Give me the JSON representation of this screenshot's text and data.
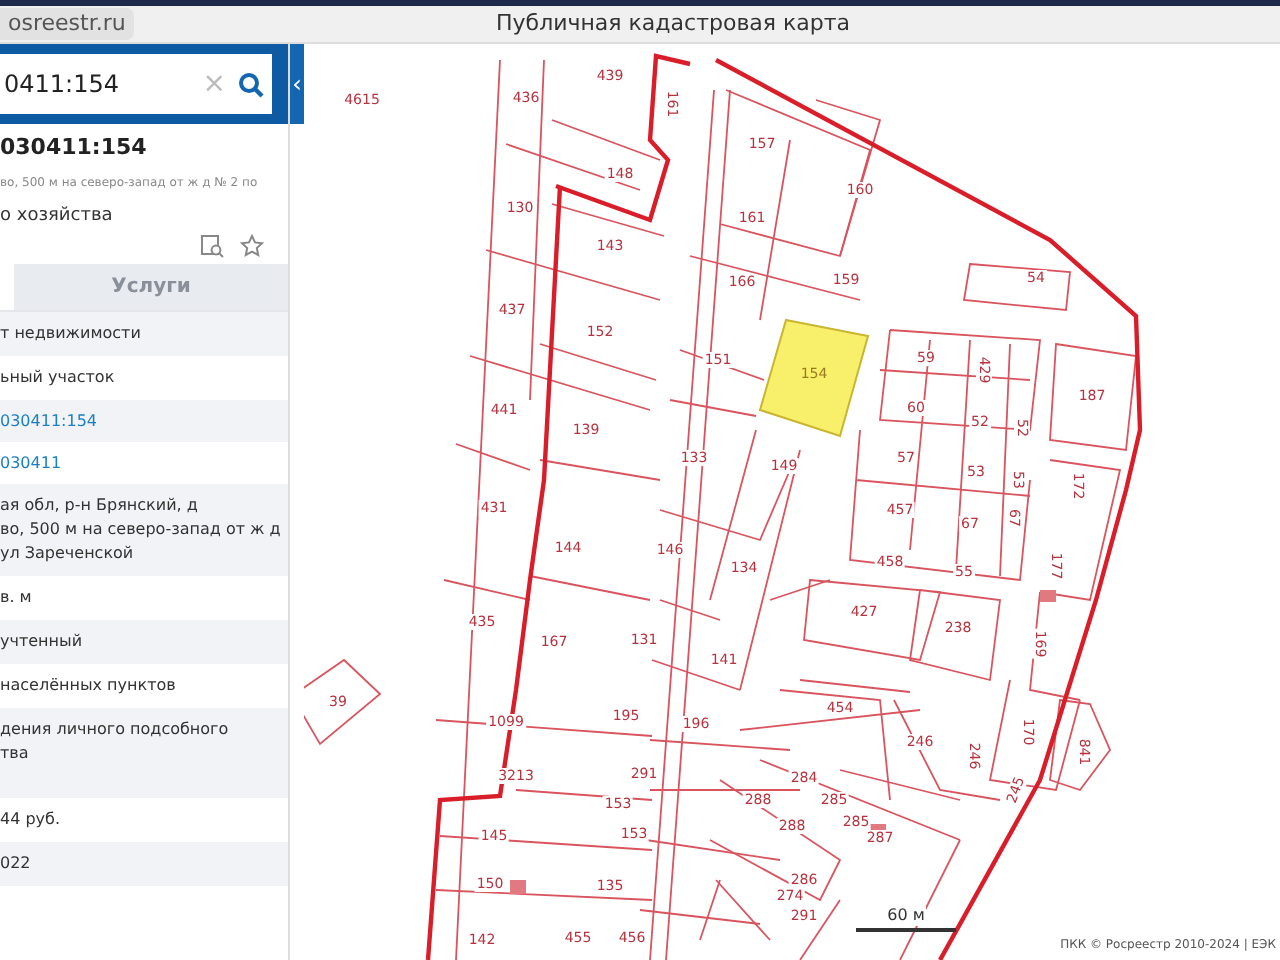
{
  "browser": {
    "url": "osreestr.ru",
    "title": "Публичная кадастровая карта"
  },
  "search": {
    "value": "0411:154",
    "clear": "×"
  },
  "collapse": "‹",
  "object": {
    "title": "030411:154",
    "address": "во, 500 м на северо-запад от ж д № 2 по",
    "usage": "о хозяйства"
  },
  "tabs": [
    {
      "label": "Услуги",
      "selected": false
    }
  ],
  "rows": [
    {
      "kind": "text",
      "lines": [
        "т недвижимости"
      ]
    },
    {
      "kind": "text",
      "lines": [
        "ьный участок"
      ]
    },
    {
      "kind": "link",
      "lines": [
        "030411:154"
      ]
    },
    {
      "kind": "link",
      "lines": [
        "030411"
      ]
    },
    {
      "kind": "text",
      "lines": [
        "ая обл, р-н Брянский, д",
        "во, 500 м на северо-запад от ж д",
        "ул Зареченской"
      ]
    },
    {
      "kind": "text",
      "lines": [
        "в. м"
      ]
    },
    {
      "kind": "text",
      "lines": [
        "учтенный"
      ]
    },
    {
      "kind": "text",
      "lines": [
        "населённых пунктов"
      ]
    },
    {
      "kind": "text",
      "lines": [
        "дения личного подсобного",
        "тва"
      ]
    },
    {
      "kind": "text",
      "lines": [
        "44 руб."
      ]
    },
    {
      "kind": "text",
      "lines": [
        "022"
      ]
    }
  ],
  "map": {
    "parcels": [
      {
        "number": "4615",
        "selected": false
      },
      {
        "number": "436",
        "selected": false
      },
      {
        "number": "439",
        "selected": false
      },
      {
        "number": "161",
        "selected": false
      },
      {
        "number": "157",
        "selected": false
      },
      {
        "number": "160",
        "selected": false
      },
      {
        "number": "148",
        "selected": false
      },
      {
        "number": "130",
        "selected": false
      },
      {
        "number": "143",
        "selected": false
      },
      {
        "number": "161",
        "selected": false
      },
      {
        "number": "166",
        "selected": false
      },
      {
        "number": "159",
        "selected": false
      },
      {
        "number": "54",
        "selected": false
      },
      {
        "number": "437",
        "selected": false
      },
      {
        "number": "152",
        "selected": false
      },
      {
        "number": "151",
        "selected": false
      },
      {
        "number": "154",
        "selected": true
      },
      {
        "number": "59",
        "selected": false
      },
      {
        "number": "429",
        "selected": false
      },
      {
        "number": "187",
        "selected": false
      },
      {
        "number": "60",
        "selected": false
      },
      {
        "number": "52",
        "selected": false
      },
      {
        "number": "52",
        "selected": false
      },
      {
        "number": "441",
        "selected": false
      },
      {
        "number": "139",
        "selected": false
      },
      {
        "number": "133",
        "selected": false
      },
      {
        "number": "149",
        "selected": false
      },
      {
        "number": "57",
        "selected": false
      },
      {
        "number": "53",
        "selected": false
      },
      {
        "number": "53",
        "selected": false
      },
      {
        "number": "172",
        "selected": false
      },
      {
        "number": "431",
        "selected": false
      },
      {
        "number": "144",
        "selected": false
      },
      {
        "number": "146",
        "selected": false
      },
      {
        "number": "134",
        "selected": false
      },
      {
        "number": "457",
        "selected": false
      },
      {
        "number": "67",
        "selected": false
      },
      {
        "number": "67",
        "selected": false
      },
      {
        "number": "458",
        "selected": false
      },
      {
        "number": "55",
        "selected": false
      },
      {
        "number": "177",
        "selected": false
      },
      {
        "number": "435",
        "selected": false
      },
      {
        "number": "167",
        "selected": false
      },
      {
        "number": "131",
        "selected": false
      },
      {
        "number": "141",
        "selected": false
      },
      {
        "number": "427",
        "selected": false
      },
      {
        "number": "238",
        "selected": false
      },
      {
        "number": "169",
        "selected": false
      },
      {
        "number": "39",
        "selected": false
      },
      {
        "number": "1099",
        "selected": false
      },
      {
        "number": "195",
        "selected": false
      },
      {
        "number": "196",
        "selected": false
      },
      {
        "number": "454",
        "selected": false
      },
      {
        "number": "246",
        "selected": false
      },
      {
        "number": "246",
        "selected": false
      },
      {
        "number": "170",
        "selected": false
      },
      {
        "number": "841",
        "selected": false
      },
      {
        "number": "3213",
        "selected": false
      },
      {
        "number": "291",
        "selected": false
      },
      {
        "number": "284",
        "selected": false
      },
      {
        "number": "153",
        "selected": false
      },
      {
        "number": "288",
        "selected": false
      },
      {
        "number": "285",
        "selected": false
      },
      {
        "number": "145",
        "selected": false
      },
      {
        "number": "153",
        "selected": false
      },
      {
        "number": "288",
        "selected": false
      },
      {
        "number": "285",
        "selected": false
      },
      {
        "number": "287",
        "selected": false
      },
      {
        "number": "286",
        "selected": false
      },
      {
        "number": "274",
        "selected": false
      },
      {
        "number": "245",
        "selected": false
      },
      {
        "number": "150",
        "selected": false
      },
      {
        "number": "135",
        "selected": false
      },
      {
        "number": "291",
        "selected": false
      },
      {
        "number": "142",
        "selected": false
      },
      {
        "number": "455",
        "selected": false
      },
      {
        "number": "456",
        "selected": false
      }
    ],
    "scale": "60 м",
    "attribution": "ПКК © Росреестр 2010-2024 | ЕЭК"
  }
}
